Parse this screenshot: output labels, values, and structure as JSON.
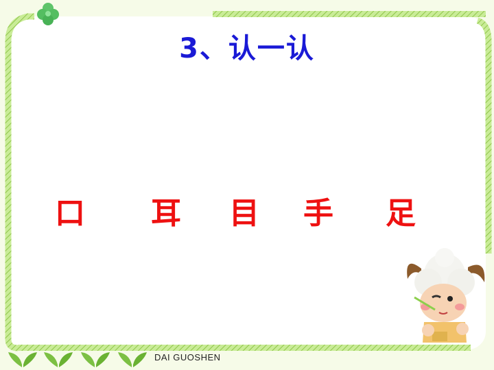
{
  "slide": {
    "title": "3、认一认",
    "characters": [
      "口",
      "耳",
      "目",
      "手",
      "足"
    ],
    "footer": "DAI  GUOSHEN"
  },
  "colors": {
    "title": "#1a1ad6",
    "characters": "#ee1111",
    "frame": "#9fd35a",
    "background": "#f6fbe8"
  },
  "icons": [
    "clover-icon",
    "sprout-icon",
    "sheep-illustration"
  ]
}
